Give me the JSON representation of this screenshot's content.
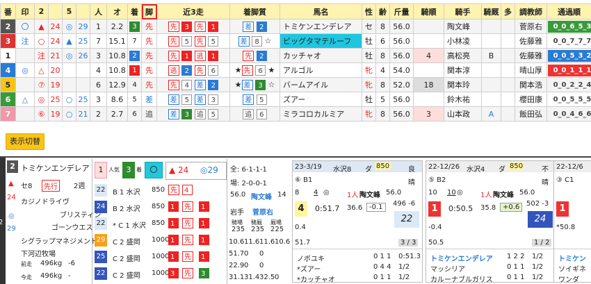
{
  "columns": [
    "番",
    "印",
    "2",
    "",
    "5",
    "",
    "人",
    "オ",
    "着",
    "脚",
    "近3走",
    "着脚質",
    "",
    "馬名",
    "性",
    "齢",
    "斤量",
    "騎順",
    "",
    "騎手",
    "騎厩",
    "多",
    "調教師",
    "通過順"
  ],
  "rows": [
    {
      "no": "2",
      "nocolor": "#555",
      "mark": "〇",
      "c2": "▲",
      "c3": "24",
      "c4": "◎",
      "c5": "29",
      "pop": "1",
      "odds": "2.2",
      "fin": "3",
      "fincolor": "green",
      "leg": "先",
      "r1": "先",
      "r1n": "3",
      "r1c": "red",
      "r2": "先",
      "r2n": "1",
      "r2c": "red",
      "r3": "差",
      "r3n": "2",
      "r3c": "blue",
      "star2": "",
      "star3": "",
      "name": "トミケンエンデレア",
      "namebg": "",
      "sex": "セ",
      "age": "8",
      "wt": "56.0",
      "jorder": "",
      "jcolor": "",
      "jockey": "陶文峰",
      "jk": "",
      "tr": "菅原右",
      "pass": "0_0_6_5_3",
      "passbg": "#3a9a3a"
    },
    {
      "no": "3",
      "nocolor": "#d33",
      "mark": "注",
      "c2": "○",
      "c3": "24",
      "c4": "▲",
      "c5": "25",
      "pop": "7",
      "odds": "15.1",
      "fin": "7",
      "fincolor": "plain",
      "leg": "先",
      "r1": "先",
      "r1n": "5",
      "r1c": "plain",
      "r2": "先",
      "r2n": "5",
      "r2c": "plain",
      "r3": "差",
      "r3n": "8",
      "r3c": "plain",
      "star2": "",
      "star3": "☆",
      "name": "ビッグタマテルーフ",
      "namebg": "#1ec6e0",
      "sex": "牡",
      "age": "6",
      "wt": "56.0",
      "jorder": "",
      "jcolor": "",
      "jockey": "小林凌",
      "jk": "",
      "tr": "佐藤雅",
      "pass": "0_0_7_7_7",
      "passbg": ""
    },
    {
      "no": "1",
      "nocolor": "#fff",
      "mark": "",
      "c2": "注",
      "c3": "21",
      "c4": "◎",
      "c5": "26",
      "pop": "3",
      "odds": "10.8",
      "fin": "2",
      "fincolor": "blue",
      "leg": "先",
      "r1": "先",
      "r1n": "1",
      "r1c": "red",
      "r2": "逃",
      "r2n": "1",
      "r2c": "red",
      "r3": "先",
      "r3n": "2",
      "r3c": "blue",
      "star2": "",
      "star3": "",
      "name": "カッチャオ",
      "namebg": "",
      "sex": "牡",
      "age": "8",
      "wt": "56.0",
      "jorder": "4",
      "jcolor": "#fdd",
      "jockey": "高松亮",
      "jk": "B",
      "tr": "佐藤雅",
      "pass": "0_0_5_3_2",
      "passbg": "#2a7bd3"
    },
    {
      "no": "4",
      "nocolor": "#2a7bd3",
      "mark": "◎",
      "c2": "△",
      "c3": "20",
      "c4": "",
      "c5": "",
      "pop": "4",
      "odds": "10.8",
      "fin": "1",
      "fincolor": "red",
      "leg": "先",
      "r1": "逃",
      "r1n": "2",
      "r1c": "blue",
      "r2": "先",
      "r2n": "6",
      "r2c": "plain",
      "r3": "先",
      "r3n": "6",
      "r3c": "plain",
      "star2": "★",
      "star3": "★",
      "name": "アルゴル",
      "namebg": "",
      "sex": "牝",
      "age": "4",
      "wt": "54.0",
      "jorder": "",
      "jcolor": "",
      "jockey": "関本淳",
      "jk": "",
      "tr": "晴山厚",
      "pass": "0_0_1_1_1",
      "passbg": "#e33"
    },
    {
      "no": "5",
      "nocolor": "#f7c418",
      "mark": "",
      "c2": "⑦",
      "c3": "19",
      "c4": "",
      "c5": "",
      "pop": "6",
      "odds": "12.9",
      "fin": "4",
      "fincolor": "plain",
      "leg": "先",
      "r1": "先",
      "r1n": "4",
      "r1c": "plain",
      "r2": "差",
      "r2n": "2",
      "r2c": "blue",
      "r3": "差",
      "r3n": "3",
      "r3c": "green",
      "star2": "★",
      "star3": "☆",
      "name": "バームアイル",
      "namebg": "",
      "sex": "牝",
      "age": "8",
      "wt": "52.0",
      "jorder": "18",
      "jcolor": "#ddd",
      "jockey": "関本玲",
      "jk": "",
      "tr": "関本浩",
      "pass": "0_0_2_2_4",
      "passbg": ""
    },
    {
      "no": "6",
      "nocolor": "#3a9a3a",
      "mark": "△",
      "c2": "◎",
      "c3": "25",
      "c4": "○",
      "c5": "25",
      "pop": "3",
      "odds": "8.6",
      "fin": "5",
      "fincolor": "plain",
      "leg": "差",
      "r1": "差",
      "r1n": "5",
      "r1c": "plain",
      "r2": "差",
      "r2n": "3",
      "r2c": "plain",
      "r3": "差",
      "r3n": "5",
      "r3c": "plain",
      "star2": "",
      "star3": "",
      "name": "ズアー",
      "namebg": "",
      "sex": "牡",
      "age": "5",
      "wt": "56.0",
      "jorder": "",
      "jcolor": "",
      "jockey": "鈴木祐",
      "jk": "",
      "tr": "櫻田康",
      "pass": "0_0_5_5_5",
      "passbg": ""
    },
    {
      "no": "7",
      "nocolor": "#e9a",
      "mark": "",
      "c2": "⑥",
      "c3": "19",
      "c4": "○",
      "c5": "21",
      "pop": "2",
      "odds": "2.7",
      "fin": "6",
      "fincolor": "plain",
      "leg": "追",
      "r1": "差",
      "r1n": "3",
      "r1c": "green",
      "r2": "追",
      "r2n": "5",
      "r2c": "plain",
      "r3": "追",
      "r3n": "6",
      "r3c": "plain",
      "star2": "",
      "star3": "",
      "name": "ミラコロカルミア",
      "namebg": "",
      "sex": "牝",
      "age": "8",
      "wt": "56.0",
      "jorder": "3",
      "jcolor": "#fdd",
      "jockey": "山本政",
      "jk": "A",
      "tr": "飯田弘",
      "pass": "0_0_4_6_6",
      "passbg": ""
    }
  ],
  "toggle_label": "表示切替",
  "detail": {
    "no": "2",
    "name": "トミケンエンデレア",
    "sexage": "セ8",
    "style": "先行",
    "interval": "2週",
    "pop_label": "人気",
    "pop": "1",
    "fin": "3",
    "fin_label": "着",
    "mark": "〇",
    "tri": "▲ 24",
    "circ": "◎29",
    "left_mark1": "▲",
    "left_val1": "24",
    "left_mark2": "◎",
    "left_val2": "29",
    "side_no": "2",
    "sire": "カジノドライヴ",
    "dam": "ブリスティン",
    "damsire": "ゴーンウエスト",
    "owner": "シグラップマネジメント",
    "breeder": "下河辺牧場",
    "prev_label": "前走",
    "prev_wt": "496kg",
    "prev_diff": "-6",
    "now_label": "今走",
    "now_wt": "496kg",
    "now_diff": "-",
    "class_rows": [
      {
        "n": "22",
        "cls": "B 1 水沢",
        "d": "850",
        "a": "先",
        "b": "4"
      },
      {
        "n": "24",
        "cls": "B 2 水沢",
        "d": "850",
        "a": "1",
        "b": "先",
        "x": "1"
      },
      {
        "n": "22",
        "cls": "* C 1 水沢",
        "d": "850",
        "a": "1",
        "b": "先",
        "x": "1"
      },
      {
        "n": "29",
        "cls": "C 2 盛岡",
        "d": "1000",
        "a": "1",
        "b": "先",
        "x": "1"
      },
      {
        "n": "25",
        "cls": "C 2 盛岡",
        "d": "1000",
        "a": "1",
        "b": "先",
        "x": "1"
      },
      {
        "n": "22",
        "cls": "C 2 盛岡",
        "d": "1000",
        "a": "3",
        "b": "先",
        "x": "3"
      }
    ],
    "stats_all": "全: 6-1-1-1",
    "stats_course": "場: 2-0-0-1",
    "stats_wt": "56.0",
    "stats_jockey": "陶文峰",
    "stats_jnum": "14",
    "stats_rider_label": "岩手",
    "stats_trainer": "菅原右",
    "stat_heads": [
      "騎場",
      "騎厩",
      "厩場"
    ],
    "stat_vals": [
      "235",
      "235",
      "225"
    ],
    "grid_rows": [
      [
        "10.6",
        "11.6",
        "11.6",
        "10.6"
      ],
      [
        "51.7",
        "0",
        "0"
      ],
      [
        "22.9",
        "0",
        "0"
      ],
      [
        "31.1",
        "31.4",
        "32.5",
        "0"
      ]
    ]
  },
  "races": [
    {
      "date": "23-3/19",
      "course": "水沢8",
      "dist_label": "ダ",
      "dist": "850",
      "cond": "良",
      "weather": "晴",
      "place_no": "⑥ B1",
      "field": "8",
      "gate": "4",
      "horse": "◎",
      "pop": "1人",
      "jockey": "陶文峰",
      "wt": "56.0",
      "fin": "4",
      "time": "0:51.7",
      "last": "36.6",
      "diff": "-0.1",
      "weight": "496 -6",
      "idx": "22",
      "note1": "0.4",
      "pass": "3 / 3",
      "time2": "51.7",
      "rows": [
        [
          "ノボユキ",
          "0 1 1",
          "0:51.3"
        ],
        [
          "*ズアー",
          "0 4 4",
          "1/2"
        ],
        [
          "*カッチャオ",
          "0 1 1",
          "1/2"
        ]
      ]
    },
    {
      "date": "22-12/26",
      "course": "水沢4",
      "dist_label": "ダ",
      "dist": "850",
      "cond": "不",
      "weather": "晴",
      "place_no": "⑤ B2",
      "field": "10",
      "gate": "10",
      "horse": "◎",
      "pop": "1人",
      "jockey": "陶文峰",
      "wt": "56.0",
      "fin": "1",
      "time": "0:50.5",
      "last": "35.8",
      "diff": "+0.6",
      "weight": "502 -3",
      "idx": "24",
      "note1": "-0.4",
      "pass": "1 / 2",
      "time2": "50.5",
      "rows": [
        [
          "トミケンエンデレア",
          "1 2 2",
          "1/2"
        ],
        [
          "マッシリア",
          "0 1 1",
          "1/2"
        ],
        [
          "カルーナブルガリス",
          "0 1 1",
          "1/2"
        ]
      ]
    },
    {
      "date": "22-12/6",
      "course": "",
      "dist_label": "",
      "dist": "",
      "cond": "",
      "weather": "",
      "place_no": "③ C1",
      "field": "",
      "gate": "",
      "horse": "",
      "pop": "",
      "jockey": "",
      "wt": "",
      "fin": "1",
      "time": "",
      "last": "",
      "diff": "",
      "weight": "",
      "idx": "",
      "note1": "*50.8",
      "pass": "",
      "time2": "",
      "rows": [
        [
          "トミケン",
          "",
          ""
        ],
        [
          "ソイギネ",
          "",
          ""
        ],
        [
          "ワンダ",
          "",
          ""
        ]
      ]
    }
  ]
}
